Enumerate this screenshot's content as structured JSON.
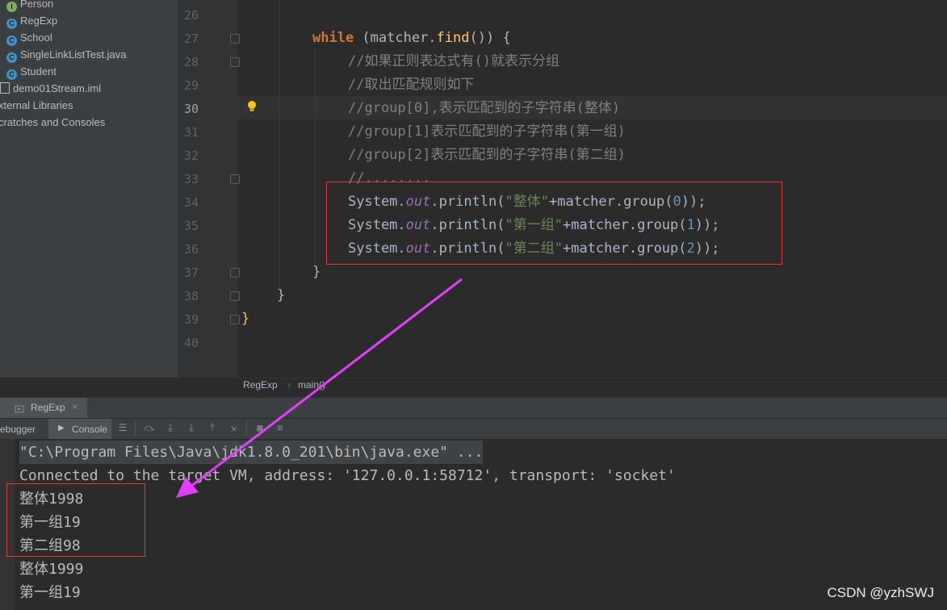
{
  "project_tree": [
    {
      "label": "Person",
      "icon": "interface-icon"
    },
    {
      "label": "RegExp",
      "icon": "class-icon"
    },
    {
      "label": "School",
      "icon": "class-icon"
    },
    {
      "label": "SingleLinkListTest.java",
      "icon": "class-icon"
    },
    {
      "label": "Student",
      "icon": "class-icon"
    },
    {
      "label": "demo01Stream.iml",
      "icon": "file-icon"
    },
    {
      "label": "xternal Libraries",
      "icon": ""
    },
    {
      "label": "cratches and Consoles",
      "icon": ""
    }
  ],
  "line_numbers": [
    "26",
    "27",
    "28",
    "29",
    "30",
    "31",
    "32",
    "33",
    "34",
    "35",
    "36",
    "37",
    "38",
    "39",
    "40"
  ],
  "code": {
    "while_kw": "while",
    "while_rest_1": " (matcher.",
    "while_fn": "find",
    "while_rest_2": "()) {",
    "c28": "//如果正则表达式有()就表示分组",
    "c29": "//取出匹配规则如下",
    "c30": "//group[0],表示匹配到的子字符串(整体)",
    "c31": "//group[1]表示匹配到的子字符串(第一组)",
    "c32": "//group[2]表示匹配到的子字符串(第二组)",
    "c33": "//........",
    "prints": [
      {
        "pre": "System.",
        "fld": "out",
        "mid": ".println(",
        "str": "\"整体\"",
        "post": "+matcher.group(",
        "num": "0",
        "end": "));"
      },
      {
        "pre": "System.",
        "fld": "out",
        "mid": ".println(",
        "str": "\"第一组\"",
        "post": "+matcher.group(",
        "num": "1",
        "end": "));"
      },
      {
        "pre": "System.",
        "fld": "out",
        "mid": ".println(",
        "str": "\"第二组\"",
        "post": "+matcher.group(",
        "num": "2",
        "end": "));"
      }
    ],
    "close37": "}",
    "close38": "}",
    "close39": "}"
  },
  "breadcrumb": {
    "class": "RegExp",
    "sep": "›",
    "method": "main()"
  },
  "run_window": {
    "tab_label": "RegExp",
    "debugger_tab": "ebugger",
    "console_tab": "Console"
  },
  "console_lines": [
    "\"C:\\Program Files\\Java\\jdk1.8.0_201\\bin\\java.exe\" ...",
    "Connected to the target VM, address: '127.0.0.1:58712', transport: 'socket'",
    "整体1998",
    "第一组19",
    "第二组98",
    "整体1999",
    "第一组19"
  ],
  "watermark": "CSDN @yzhSWJ",
  "colors": {
    "annotation_box": "#e53935",
    "arrow": "#e040fb"
  }
}
